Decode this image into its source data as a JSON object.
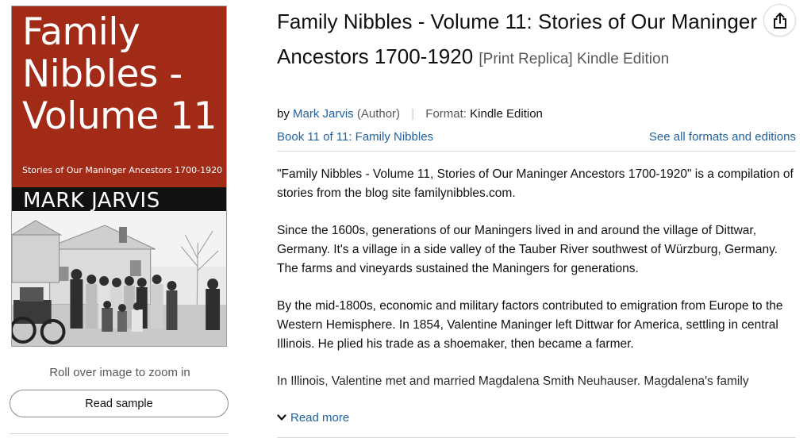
{
  "cover": {
    "title_lines": [
      "Family",
      "Nibbles -",
      "Volume 11"
    ],
    "subtitle": "Stories of Our Maninger Ancestors 1700-1920",
    "author": "MARK JARVIS",
    "colors": {
      "top": "#a12b17",
      "band": "#111111"
    }
  },
  "image_panel": {
    "zoom_hint": "Roll over image to zoom in",
    "read_sample_label": "Read sample"
  },
  "product": {
    "title": "Family Nibbles - Volume 11: Stories of Our Maninger Ancestors 1700-1920",
    "binding": "[Print Replica] Kindle Edition",
    "by_label": "by",
    "author_name": "Mark Jarvis",
    "author_role": "(Author)",
    "format_label": "Format:",
    "format_value": "Kindle Edition",
    "series": "Book 11 of 11: Family Nibbles",
    "all_formats_link": "See all formats and editions",
    "share_icon": "share-icon"
  },
  "description": {
    "paragraphs": [
      "\"Family Nibbles - Volume 11, Stories of Our Maninger Ancestors 1700-1920\" is a compilation of stories from the blog site familynibbles.com.",
      "Since the 1600s, generations of our Maningers lived in and around the village of Dittwar, Germany. It's a village in a side valley of the Tauber River southwest of Würzburg, Germany. The farms and vineyards sustained the Maningers for generations.",
      "By the mid-1800s, economic and military factors contributed to emigration from Europe to the Western Hemisphere. In 1854, Valentine Maninger left Dittwar for America, settling in central Illinois. He plied his trade as a shoemaker, then became a farmer.",
      "In Illinois, Valentine met and married Magdalena Smith Neuhauser. Magdalena's family"
    ],
    "read_more_label": "Read more"
  },
  "colors": {
    "link": "#2162a1",
    "text": "#0f1111",
    "muted": "#565959"
  }
}
